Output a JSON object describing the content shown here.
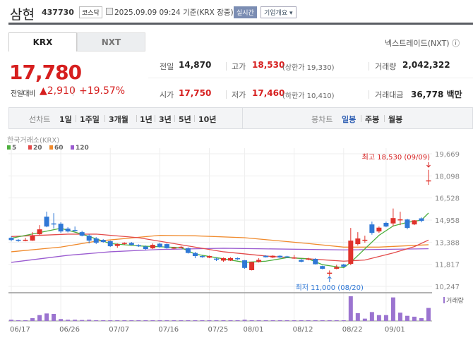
{
  "header": {
    "title": "삼현",
    "code": "437730",
    "market": "코스닥",
    "datetime": "2025.09.09 09:24",
    "basis": "기준(KRX 장중)",
    "realtime_label": "실시간",
    "company_label": "기업개요 ▾"
  },
  "tabs": [
    {
      "label": "KRX",
      "active": true
    },
    {
      "label": "NXT",
      "active": false
    }
  ],
  "nxt_link": "넥스트레이드(NXT) ⓘ",
  "quote": {
    "price": "17,780",
    "change_label": "전일대비",
    "change": "▲2,910",
    "change_pct": "+19.57%"
  },
  "info": {
    "prev_close": {
      "label": "전일",
      "value": "14,870"
    },
    "open": {
      "label": "시가",
      "value": "17,750"
    },
    "high": {
      "label": "고가",
      "value": "18,530",
      "sub": "(상한가 19,330)"
    },
    "low": {
      "label": "저가",
      "value": "17,460",
      "sub": "(하한가 10,410)"
    },
    "volume": {
      "label": "거래량",
      "value": "2,042,322"
    },
    "amount": {
      "label": "거래대금",
      "value": "36,778 백만"
    }
  },
  "toolbar": {
    "line_label": "선차트",
    "line_periods": [
      "1일",
      "1주일",
      "3개월",
      "1년",
      "3년",
      "5년",
      "10년"
    ],
    "candle_label": "봉차트",
    "candle_periods": [
      "일봉",
      "주봉",
      "월봉"
    ],
    "active_candle": "일봉"
  },
  "colors": {
    "up": "#e0322b",
    "down": "#2f78d6",
    "ma5": "#4caf3c",
    "ma20": "#e34a4a",
    "ma60": "#f08a2c",
    "ma120": "#9a5bd0",
    "volume": "#9b74d0"
  },
  "chart_data": {
    "type": "candlestick",
    "source_label": "한국거래소(KRX)",
    "legend": [
      "5",
      "20",
      "60",
      "120"
    ],
    "y_ticks": [
      "19,669",
      "18,098",
      "16,528",
      "14,958",
      "13,388",
      "11,817",
      "10,247"
    ],
    "ylim": [
      10247,
      19669
    ],
    "x_labels": [
      {
        "i": 0,
        "t": "06/17"
      },
      {
        "i": 7,
        "t": "06/26"
      },
      {
        "i": 14,
        "t": "07/07"
      },
      {
        "i": 21,
        "t": "07/16"
      },
      {
        "i": 28,
        "t": "07/25"
      },
      {
        "i": 33,
        "t": "08/01"
      },
      {
        "i": 40,
        "t": "08/12"
      },
      {
        "i": 47,
        "t": "08/22"
      },
      {
        "i": 53,
        "t": "09/01"
      }
    ],
    "ohlc": [
      [
        13700,
        13800,
        13450,
        13540
      ],
      [
        13560,
        13600,
        13420,
        13480
      ],
      [
        13480,
        13700,
        13450,
        13560
      ],
      [
        13500,
        14100,
        13480,
        13850
      ],
      [
        13950,
        14600,
        13900,
        14300
      ],
      [
        15200,
        15560,
        14450,
        14500
      ],
      [
        14720,
        15450,
        14350,
        14700
      ],
      [
        14700,
        14800,
        14050,
        14150
      ],
      [
        14350,
        14450,
        14080,
        14150
      ],
      [
        14250,
        14500,
        14150,
        14200
      ],
      [
        14100,
        14200,
        13800,
        13850
      ],
      [
        13850,
        13950,
        13300,
        13500
      ],
      [
        13650,
        13750,
        13250,
        13350
      ],
      [
        13550,
        13600,
        13350,
        13400
      ],
      [
        13460,
        13500,
        13050,
        13100
      ],
      [
        13120,
        13300,
        12990,
        13250
      ],
      [
        13260,
        13380,
        13200,
        13340
      ],
      [
        13340,
        13400,
        13150,
        13200
      ],
      [
        13180,
        13240,
        13050,
        13100
      ],
      [
        13080,
        13150,
        12820,
        12900
      ],
      [
        12950,
        13300,
        12900,
        13200
      ],
      [
        13280,
        13350,
        13000,
        13050
      ],
      [
        13250,
        13300,
        12920,
        12960
      ],
      [
        12990,
        13060,
        12880,
        13010
      ],
      [
        13030,
        13120,
        13000,
        13060
      ],
      [
        12960,
        13020,
        12580,
        12620
      ],
      [
        12620,
        12700,
        12250,
        12400
      ],
      [
        12400,
        12450,
        12280,
        12350
      ],
      [
        12290,
        12440,
        12250,
        12400
      ],
      [
        12220,
        12300,
        12050,
        12200
      ],
      [
        12080,
        12300,
        12000,
        12250
      ],
      [
        12080,
        12320,
        12050,
        12260
      ],
      [
        12250,
        12300,
        12130,
        12180
      ],
      [
        12100,
        12120,
        11500,
        11560
      ],
      [
        11400,
        12000,
        11380,
        11980
      ],
      [
        11980,
        12250,
        11940,
        12130
      ],
      [
        12420,
        12460,
        12300,
        12320
      ],
      [
        12300,
        12460,
        12260,
        12420
      ],
      [
        12420,
        12460,
        12260,
        12300
      ],
      [
        12380,
        12420,
        12300,
        12340
      ],
      [
        12240,
        12480,
        12200,
        12300
      ],
      [
        12130,
        12200,
        11950,
        12000
      ],
      [
        12150,
        12280,
        12100,
        12230
      ],
      [
        12200,
        12250,
        11800,
        11820
      ],
      [
        11690,
        11720,
        11460,
        11500
      ],
      [
        11200,
        11380,
        11000,
        11220
      ],
      [
        11500,
        11780,
        11460,
        11620
      ],
      [
        11800,
        11850,
        11600,
        11650
      ],
      [
        11850,
        14400,
        11750,
        13500
      ],
      [
        13250,
        14100,
        13150,
        13650
      ],
      [
        13520,
        13850,
        13350,
        13560
      ],
      [
        14650,
        14850,
        13920,
        14050
      ],
      [
        14150,
        14500,
        14050,
        14420
      ],
      [
        14760,
        14850,
        14450,
        14500
      ],
      [
        14720,
        15780,
        14500,
        15100
      ],
      [
        14990,
        15550,
        14600,
        15010
      ],
      [
        15000,
        15050,
        14300,
        14400
      ],
      [
        14650,
        14960,
        14600,
        14940
      ],
      [
        15080,
        15150,
        14800,
        14900
      ],
      [
        17750,
        18530,
        17460,
        17780
      ]
    ],
    "volume": [
      190000,
      110000,
      110000,
      440000,
      920000,
      1180000,
      1110000,
      300000,
      190000,
      190000,
      150000,
      190000,
      110000,
      110000,
      110000,
      110000,
      110000,
      110000,
      110000,
      110000,
      110000,
      110000,
      110000,
      110000,
      110000,
      110000,
      110000,
      110000,
      110000,
      110000,
      110000,
      110000,
      110000,
      190000,
      110000,
      110000,
      110000,
      110000,
      110000,
      110000,
      110000,
      110000,
      110000,
      110000,
      110000,
      110000,
      110000,
      110000,
      3880000,
      1220000,
      370000,
      1400000,
      920000,
      920000,
      3700000,
      1300000,
      810000,
      670000,
      440000,
      2042322
    ],
    "ma": {
      "5": [
        [
          0,
          13670
        ],
        [
          7,
          14375
        ],
        [
          10,
          13960
        ],
        [
          14,
          13290
        ],
        [
          18,
          13123
        ],
        [
          24,
          13000
        ],
        [
          26,
          12540
        ],
        [
          30,
          12204
        ],
        [
          33,
          11954
        ],
        [
          36,
          12037
        ],
        [
          39,
          12288
        ],
        [
          42,
          12204
        ],
        [
          44,
          11787
        ],
        [
          47,
          11570
        ],
        [
          48,
          11954
        ],
        [
          52,
          13874
        ],
        [
          54,
          14542
        ],
        [
          56,
          14793
        ],
        [
          58,
          14960
        ],
        [
          59,
          15460
        ]
      ],
      "20": [
        [
          0,
          13790
        ],
        [
          8,
          13960
        ],
        [
          12,
          13960
        ],
        [
          18,
          13707
        ],
        [
          24,
          13206
        ],
        [
          30,
          12705
        ],
        [
          36,
          12405
        ],
        [
          42,
          12204
        ],
        [
          47,
          12037
        ],
        [
          50,
          12121
        ],
        [
          54,
          12622
        ],
        [
          57,
          13073
        ],
        [
          59,
          13540
        ]
      ],
      "60": [
        [
          0,
          12705
        ],
        [
          7,
          13039
        ],
        [
          12,
          13457
        ],
        [
          21,
          13874
        ],
        [
          26,
          13840
        ],
        [
          33,
          13707
        ],
        [
          42,
          13290
        ],
        [
          47,
          13039
        ],
        [
          52,
          13039
        ],
        [
          59,
          13206
        ]
      ],
      "120": [
        [
          0,
          11954
        ],
        [
          8,
          12455
        ],
        [
          14,
          12705
        ],
        [
          21,
          12872
        ],
        [
          30,
          12956
        ],
        [
          47,
          12839
        ],
        [
          59,
          12922
        ]
      ]
    },
    "annotations": {
      "high": "최고 18,530 (09/09)",
      "low": "최저 11,000 (08/20)",
      "high_index": 59,
      "low_index": 45
    },
    "volume_label": "거래량"
  }
}
